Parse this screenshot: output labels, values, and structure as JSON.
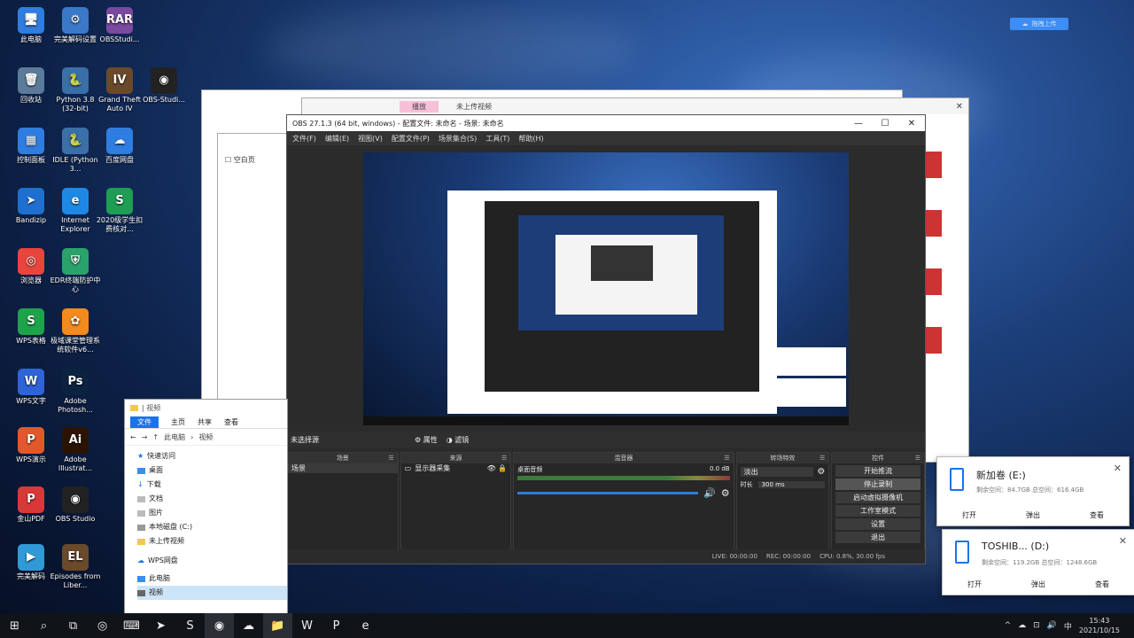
{
  "desktop_icons": [
    {
      "label": "此电脑",
      "color": "#2f7de1",
      "glyph": "🖥"
    },
    {
      "label": "完美解码设置",
      "color": "#3a78c8",
      "glyph": "⚙"
    },
    {
      "label": "OBSStudi...",
      "color": "#7a4aa0",
      "glyph": "RAR"
    },
    {
      "label": "回收站",
      "color": "#5c7a9a",
      "glyph": "🗑"
    },
    {
      "label": "Python 3.8 (32-bit)",
      "color": "#3b6fa8",
      "glyph": "🐍"
    },
    {
      "label": "Grand Theft Auto IV",
      "color": "#6a4a2a",
      "glyph": "IV"
    },
    {
      "label": "OBS-Studi...",
      "color": "#222222",
      "glyph": "◉"
    },
    {
      "label": "控制面板",
      "color": "#2f7de1",
      "glyph": "▦"
    },
    {
      "label": "IDLE (Python 3...",
      "color": "#3b6fa8",
      "glyph": "🐍"
    },
    {
      "label": "百度网盘",
      "color": "#2f7de1",
      "glyph": "☁"
    },
    {
      "label": "Bandizip",
      "color": "#1f6fd0",
      "glyph": "➤"
    },
    {
      "label": "Internet Explorer",
      "color": "#1e88e5",
      "glyph": "e"
    },
    {
      "label": "2020级学生扣费核对...",
      "color": "#1f9d55",
      "glyph": "S"
    },
    {
      "label": "浏览器",
      "color": "#e8453c",
      "glyph": "◎"
    },
    {
      "label": "EDR终端防护中心",
      "color": "#2aa36b",
      "glyph": "⛨"
    },
    {
      "label": "WPS表格",
      "color": "#1fa34a",
      "glyph": "S"
    },
    {
      "label": "极域课堂管理系统软件v6...",
      "color": "#f28a1e",
      "glyph": "✿"
    },
    {
      "label": "WPS文字",
      "color": "#2f64d6",
      "glyph": "W"
    },
    {
      "label": "Adobe Photosh...",
      "color": "#0b2240",
      "glyph": "Ps"
    },
    {
      "label": "WPS演示",
      "color": "#e0592a",
      "glyph": "P"
    },
    {
      "label": "Adobe Illustrat...",
      "color": "#2b1300",
      "glyph": "Ai"
    },
    {
      "label": "金山PDF",
      "color": "#d93838",
      "glyph": "P"
    },
    {
      "label": "OBS Studio",
      "color": "#222222",
      "glyph": "◉"
    },
    {
      "label": "完美解码",
      "color": "#2f9ad6",
      "glyph": "▶"
    },
    {
      "label": "Episodes from Liber...",
      "color": "#6a4a2a",
      "glyph": "EL"
    }
  ],
  "baidu_float": {
    "label": "拖拽上传"
  },
  "bg_window": {
    "tab1": "播放",
    "tab2": "未上传视频"
  },
  "obs": {
    "title": "OBS 27.1.3 (64 bit, windows) - 配置文件: 未命名 - 场景: 未命名",
    "controls": [
      "—",
      "☐",
      "✕"
    ],
    "menu": [
      "文件(F)",
      "编辑(E)",
      "视图(V)",
      "配置文件(P)",
      "场景集合(S)",
      "工具(T)",
      "帮助(H)"
    ],
    "source_bar": {
      "label": "未选择源",
      "properties": "属性",
      "filters": "滤镜"
    },
    "scenes": {
      "header": "场景",
      "items": [
        "场景"
      ]
    },
    "sources": {
      "header": "来源",
      "items": [
        "显示器采集"
      ]
    },
    "mixer": {
      "header": "混音器",
      "track": "桌面音频",
      "db": "0.0 dB"
    },
    "transitions": {
      "header": "转场特效",
      "type": "淡出",
      "duration_label": "时长",
      "duration": "300 ms"
    },
    "controls_dock": {
      "header": "控件",
      "buttons": [
        "开始推流",
        "停止录制",
        "启动虚拟摄像机",
        "工作室模式",
        "设置",
        "退出"
      ]
    },
    "status": {
      "live": "LIVE: 00:00:00",
      "rec": "REC: 00:00:00",
      "cpu": "CPU: 0.8%, 30.00 fps"
    }
  },
  "explorer": {
    "title": "| 视频",
    "ribbon": [
      "文件",
      "主页",
      "共享",
      "查看"
    ],
    "path": [
      "此电脑",
      "视频"
    ],
    "nav": [
      "快速访问",
      "桌面",
      "下载",
      "文档",
      "图片",
      "本地磁盘 (C:)",
      "未上传视频",
      "WPS网盘",
      "此电脑",
      "视频"
    ]
  },
  "notifications": [
    {
      "title": "新加卷 (E:)",
      "info": "剩余空间：84.7GB    总空间：616.4GB",
      "actions": [
        "打开",
        "弹出",
        "查看"
      ]
    },
    {
      "title": "TOSHIB...  (D:)",
      "info": "剩余空间：119.2GB    总空间：1248.6GB",
      "actions": [
        "打开",
        "弹出",
        "查看"
      ]
    }
  ],
  "taskbar": {
    "items": [
      "⊞",
      "⌕",
      "⧉",
      "◎",
      "⌨",
      "➤",
      "S",
      "◉",
      "☁",
      "📁",
      "W",
      "P",
      "e"
    ],
    "tray": [
      "^",
      "☁",
      "⊡",
      "🔊",
      "中"
    ],
    "time": "15:43",
    "date": "2021/10/15"
  }
}
